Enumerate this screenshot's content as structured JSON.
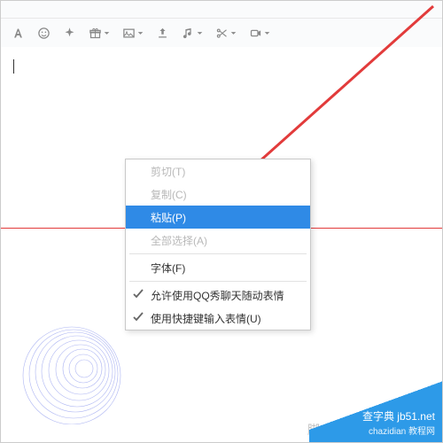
{
  "toolbar_icons": {
    "font": "font-icon",
    "emoji": "smiley-icon",
    "magic": "sparkle-icon",
    "gift": "gift-icon",
    "image": "image-icon",
    "upload": "upload-icon",
    "music": "music-icon",
    "scissors": "scissors-icon",
    "record": "record-icon"
  },
  "context_menu": {
    "cut": "剪切(T)",
    "copy": "复制(C)",
    "paste": "粘贴(P)",
    "select_all": "全部选择(A)",
    "font": "字体(F)",
    "allow_qq_show": "允许使用QQ秀聊天随动表情",
    "use_hotkey_emoji": "使用快捷键输入表情(U)"
  },
  "watermark": "脚本之家",
  "corner": {
    "line1": "查字典 jb51.net",
    "line2": " chazidian 教程网"
  }
}
